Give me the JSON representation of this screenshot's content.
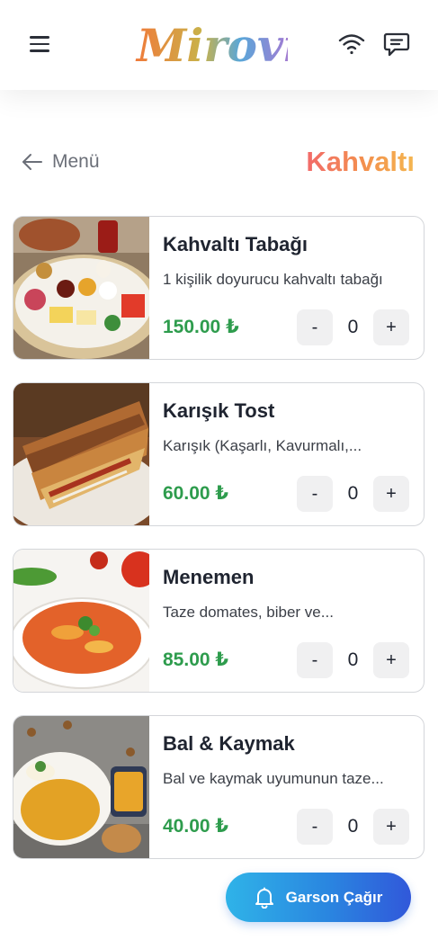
{
  "header": {
    "menu_icon": "hamburger-menu-icon",
    "logo_text": "Mirovis",
    "wifi_icon": "wifi-icon",
    "chat_icon": "chat-bubble-icon"
  },
  "nav": {
    "back_label": "Menü",
    "back_icon": "arrow-left-icon",
    "category_title": "Kahvaltı"
  },
  "colors": {
    "accent_gradient": [
      "#f26a6a",
      "#f3914d",
      "#f4b650"
    ],
    "price": "#2e9c4d",
    "button_gradient": [
      "#2fb3e8",
      "#3158da"
    ]
  },
  "products": [
    {
      "name": "Kahvaltı Tabağı",
      "description": "1 kişilik doyurucu kahvaltı tabağı",
      "price": "150.00 ₺",
      "qty_minus": "-",
      "quantity": "0",
      "qty_plus": "+",
      "image": "breakfast-plate-photo"
    },
    {
      "name": "Karışık Tost",
      "description": "Karışık (Kaşarlı, Kavurmalı,...",
      "price": "60.00 ₺",
      "qty_minus": "-",
      "quantity": "0",
      "qty_plus": "+",
      "image": "mixed-toast-photo"
    },
    {
      "name": "Menemen",
      "description": "Taze domates, biber ve...",
      "price": "85.00 ₺",
      "qty_minus": "-",
      "quantity": "0",
      "qty_plus": "+",
      "image": "menemen-photo"
    },
    {
      "name": "Bal & Kaymak",
      "description": "Bal ve kaymak uyumunun taze...",
      "price": "40.00 ₺",
      "qty_minus": "-",
      "quantity": "0",
      "qty_plus": "+",
      "image": "honey-cream-photo"
    }
  ],
  "call_waiter": {
    "label": "Garson Çağır",
    "icon": "bell-icon"
  }
}
